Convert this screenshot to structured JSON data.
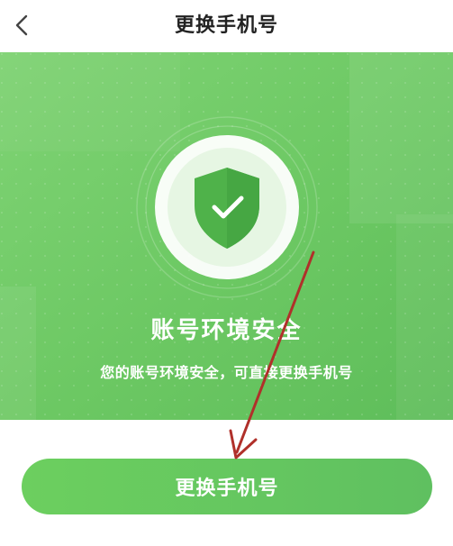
{
  "header": {
    "title": "更换手机号",
    "back_icon": "chevron-left-icon"
  },
  "status": {
    "title": "账号环境安全",
    "description": "您的账号环境安全，可直接更换手机号",
    "icon": "shield-check-icon"
  },
  "action": {
    "label": "更换手机号"
  },
  "colors": {
    "hero_green": "#6cc663",
    "button_green": "#66c85f",
    "shield_green": "#4fb24a",
    "annotation_arrow": "#b0302a"
  }
}
